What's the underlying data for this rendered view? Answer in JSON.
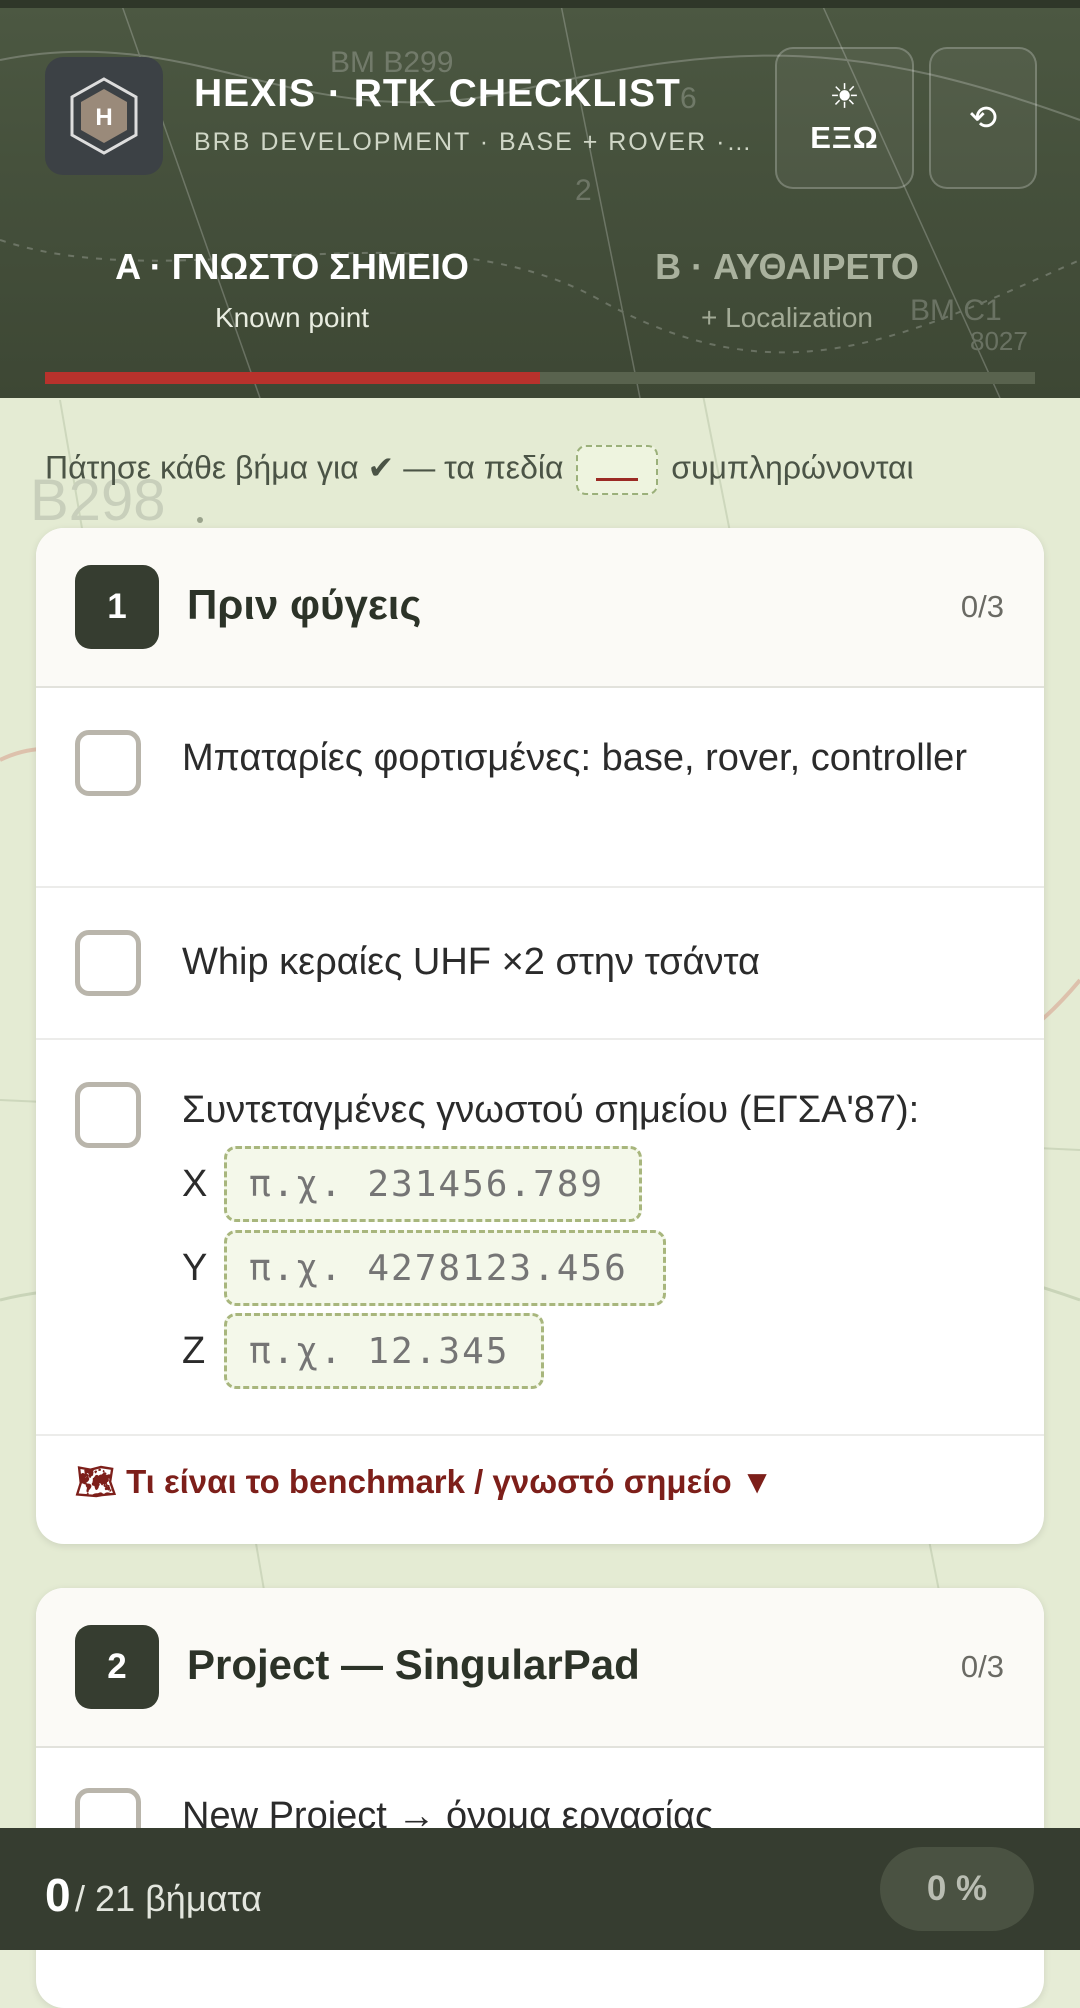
{
  "header": {
    "logo_letter": "H",
    "title": "HEXIS · RTK CHECKLIST",
    "subtitle": "BRB DEVELOPMENT · BASE + ROVER · S...",
    "outside_button": {
      "icon": "sun-icon",
      "glyph": "☀",
      "label": "ΕΞΩ"
    },
    "reset_button": {
      "icon": "reset-icon",
      "glyph": "⟲"
    }
  },
  "tabs": [
    {
      "title": "A · ΓΝΩΣΤΟ ΣΗΜΕΙΟ",
      "subtitle": "Known point",
      "active": true
    },
    {
      "title": "B · ΑΥΘΑΙΡΕΤΟ",
      "subtitle": "+ Localization",
      "active": false
    }
  ],
  "hint": {
    "before": "Πάτησε κάθε βήμα για",
    "check": "✔",
    "middle": "— τα πεδία",
    "after": "συμπληρώνονται"
  },
  "sections": [
    {
      "number": "1",
      "title": "Πριν φύγεις",
      "count": "0/3",
      "items": [
        {
          "text": "Μπαταρίες φορτισμένες: base, rover, controller"
        },
        {
          "text": "Whip κεραίες UHF ×2 στην τσάντα"
        },
        {
          "text": "Συντεταγμένες γνωστού σημείου (ΕΓΣΑ'87):"
        }
      ],
      "coords": [
        {
          "axis": "X",
          "placeholder": "π.χ. 231456.789",
          "value": ""
        },
        {
          "axis": "Y",
          "placeholder": "π.χ. 4278123.456",
          "value": ""
        },
        {
          "axis": "Z",
          "placeholder": "π.χ. 12.345",
          "value": ""
        }
      ],
      "expander": {
        "icon": "map-icon",
        "glyph": "🗺",
        "label": "Τι είναι το benchmark / γνωστό σημείο",
        "caret": "▼"
      }
    },
    {
      "number": "2",
      "title": "Project — SingularPad",
      "count": "0/3",
      "items": [
        {
          "text": "New Project → όνομα εργασίας"
        }
      ]
    }
  ],
  "progress": {
    "done": "0",
    "total_label": "/ 21 βήματα",
    "percent": "0 %"
  },
  "map_labels": [
    "BM B299",
    "6",
    "2",
    "B298",
    "BM C1",
    "8027"
  ],
  "colors": {
    "header": "#4c5842",
    "accent_red": "#b8322c",
    "dark": "#363d30",
    "field_border": "#a8b67d"
  }
}
